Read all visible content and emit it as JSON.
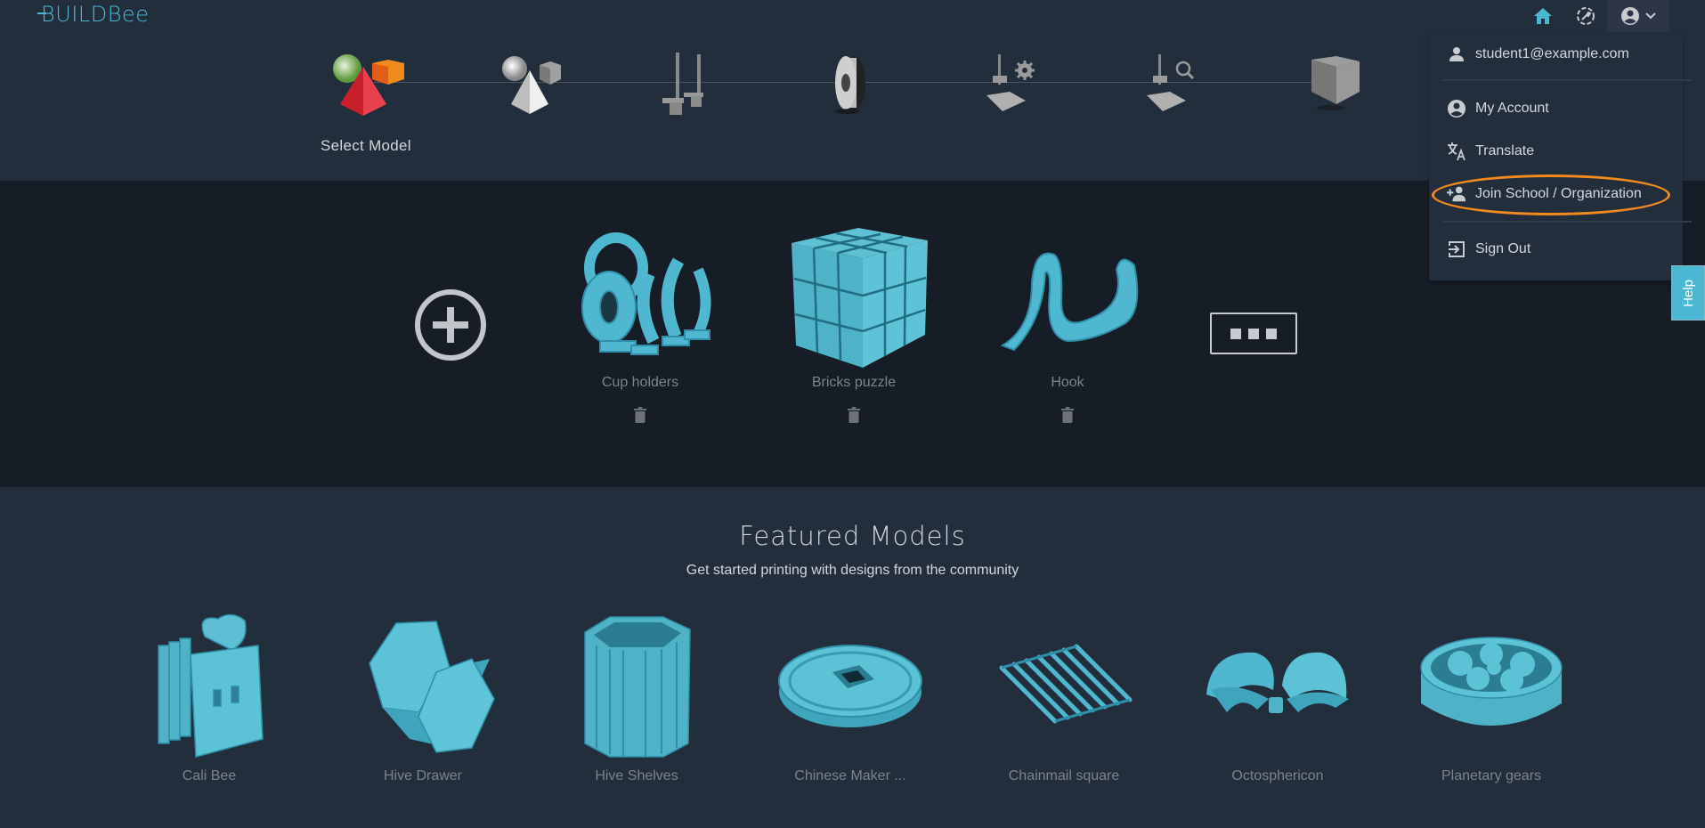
{
  "app": {
    "logo": "BUILDBee",
    "brand_color": "#4bb8d3",
    "accent_highlight": "#f28a1e"
  },
  "nav": {
    "icons": [
      "home-icon",
      "printer-status-icon",
      "account-icon"
    ]
  },
  "steps": {
    "active_label": "Select Model",
    "items": [
      {
        "name": "select-model",
        "icon": "shapes-color-icon",
        "active": true
      },
      {
        "name": "model",
        "icon": "shapes-gray-icon",
        "active": false
      },
      {
        "name": "printer",
        "icon": "printer-icon",
        "active": false
      },
      {
        "name": "filament",
        "icon": "spool-icon",
        "active": false
      },
      {
        "name": "settings",
        "icon": "printer-settings-icon",
        "active": false
      },
      {
        "name": "preview",
        "icon": "printer-preview-icon",
        "active": false
      },
      {
        "name": "print",
        "icon": "cube-icon",
        "active": false
      }
    ]
  },
  "recent": {
    "add_icon": "plus-circle-icon",
    "items": [
      {
        "name": "Cup holders"
      },
      {
        "name": "Bricks puzzle"
      },
      {
        "name": "Hook"
      }
    ],
    "more_icon": "more-icon"
  },
  "featured": {
    "title": "Featured Models",
    "subtitle": "Get started printing with designs from the community",
    "items": [
      {
        "name": "Cali Bee"
      },
      {
        "name": "Hive Drawer"
      },
      {
        "name": "Hive Shelves"
      },
      {
        "name": "Chinese Maker ..."
      },
      {
        "name": "Chainmail square"
      },
      {
        "name": "Octosphericon"
      },
      {
        "name": "Planetary gears"
      }
    ]
  },
  "account_menu": {
    "email": "student1@example.com",
    "items": [
      {
        "label": "My Account",
        "icon": "account-circle-icon"
      },
      {
        "label": "Translate",
        "icon": "translate-icon"
      },
      {
        "label": "Join School / Organization",
        "icon": "person-add-icon",
        "highlighted": true
      },
      {
        "label": "Sign Out",
        "icon": "sign-out-icon"
      }
    ]
  },
  "help": {
    "label": "Help"
  }
}
